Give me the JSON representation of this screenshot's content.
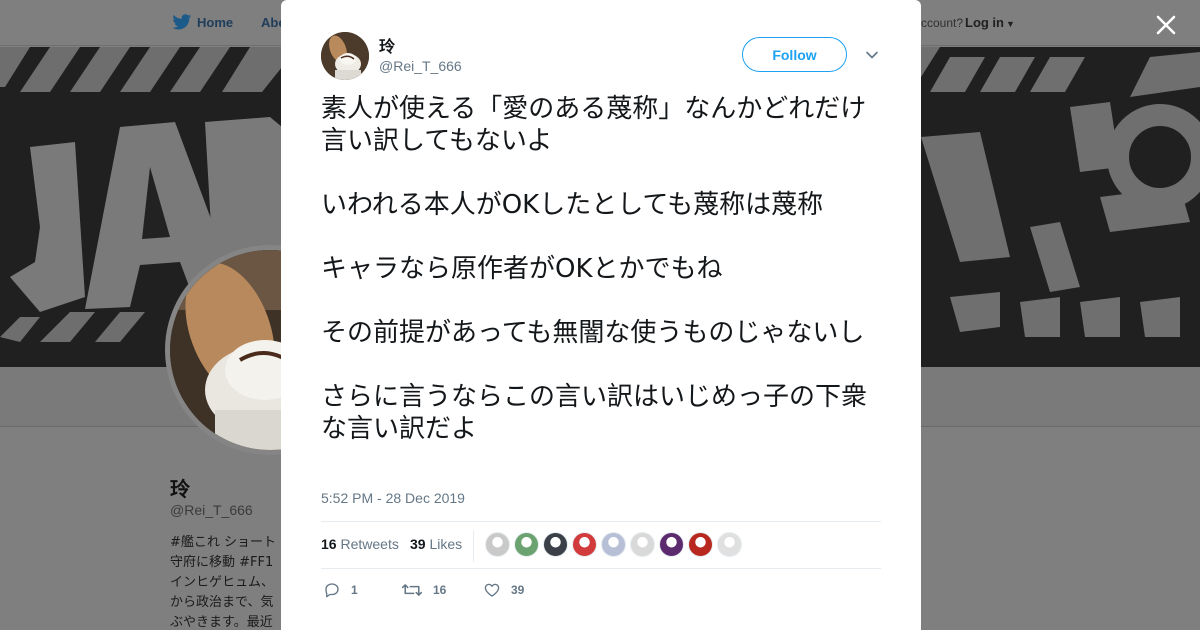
{
  "background": {
    "nav": {
      "home_label": "Home",
      "about_label": "Abo",
      "account_prompt": "ccount?",
      "login_label": "Log in"
    },
    "profile": {
      "name": "玲",
      "handle": "@Rei_T_666",
      "bio_lines": [
        "#艦これ ショート",
        "守府に移動 #FF1",
        "インヒゲヒュム、",
        "から政治まで、気",
        "ぶやきます。最近"
      ]
    }
  },
  "tweet": {
    "author_name": "玲",
    "author_handle": "@Rei_T_666",
    "follow_label": "Follow",
    "paragraphs": [
      "素人が使える「愛のある蔑称」なんかどれだけ言い訳してもないよ",
      "いわれる本人がOKしたとしても蔑称は蔑称",
      "キャラなら原作者がOKとかでもね",
      "その前提があっても無闇な使うものじゃないし",
      "さらに言うならこの言い訳はいじめっ子の下衆な言い訳だよ"
    ],
    "timestamp": "5:52 PM - 28 Dec 2019",
    "retweets_count": "16",
    "retweets_label": "Retweets",
    "likes_count": "39",
    "likes_label": "Likes",
    "liker_colors": [
      "#c9c9c9",
      "#6aa36f",
      "#3a3f48",
      "#d23b3b",
      "#b7bfd6",
      "#d9d9d9",
      "#5b2b6e",
      "#b8281f",
      "#e0e0e0"
    ],
    "actions": {
      "reply_count": "1",
      "retweet_count": "16",
      "like_count": "39"
    }
  },
  "colors": {
    "accent": "#1da1f2",
    "text_primary": "#14171a",
    "text_secondary": "#657786"
  },
  "icons": {
    "close": "close-icon",
    "caret": "chevron-down-icon",
    "reply": "reply-icon",
    "retweet": "retweet-icon",
    "like": "heart-icon",
    "logo": "twitter-bird-icon"
  }
}
